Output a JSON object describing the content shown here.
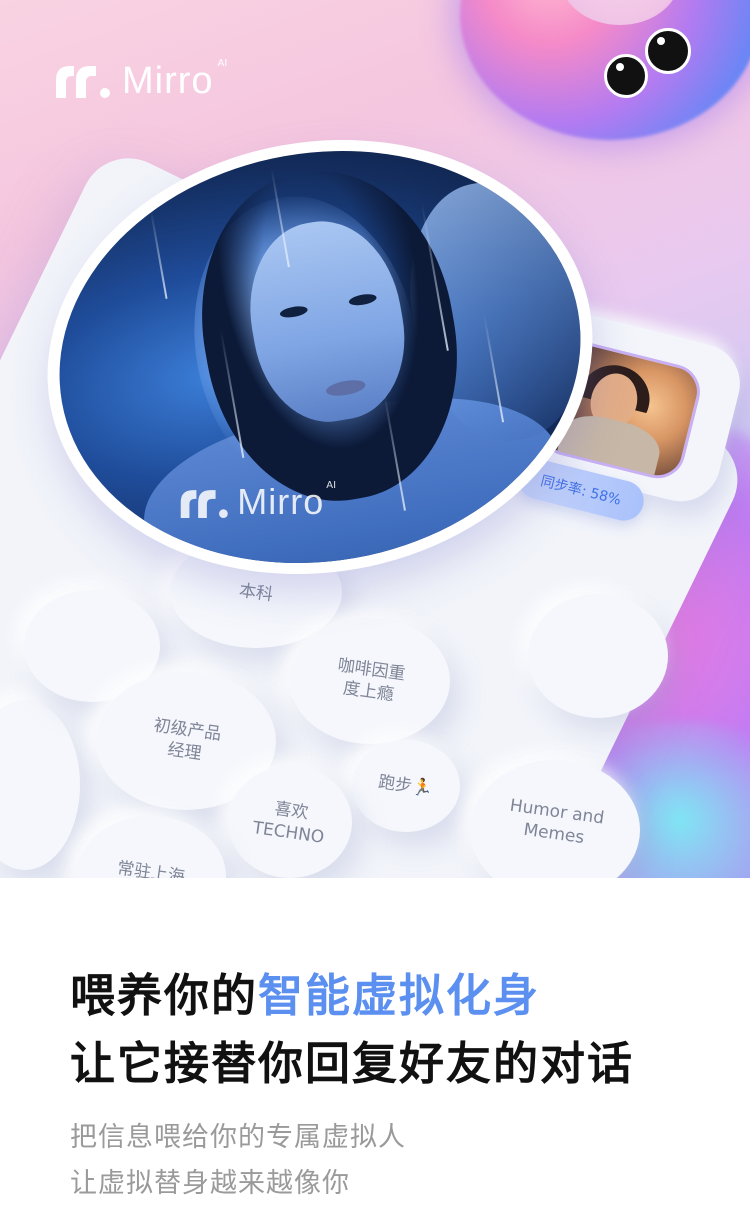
{
  "brand": {
    "name": "Mirro",
    "sup": "AI"
  },
  "watermark": {
    "name": "Mirro",
    "sup": "AI"
  },
  "sync_badge": "同步率: 58%",
  "tags": {
    "t_benke": "本科",
    "t_coffee_1": "咖啡因重",
    "t_coffee_2": "度上瘾",
    "t_pm_1": "初级产品",
    "t_pm_2": "经理",
    "t_run": "跑步🏃",
    "t_techno_1": "喜欢",
    "t_techno_2": "TECHNO",
    "t_humor_1": "Humor and",
    "t_humor_2": "Memes",
    "t_shanghai": "常驻上海"
  },
  "headline": {
    "line1_plain": "喂养你的",
    "line1_accent": "智能虚拟化身",
    "line2": "让它接替你回复好友的对话"
  },
  "subtext": {
    "line1": "把信息喂给你的专属虚拟人",
    "line2": "让虚拟替身越来越像你"
  },
  "colors": {
    "accent": "#5b8ff0",
    "headline": "#111111",
    "subtext": "#9a9a9a",
    "tag_text": "#7f8597",
    "badge_text": "#3e6fe7"
  }
}
